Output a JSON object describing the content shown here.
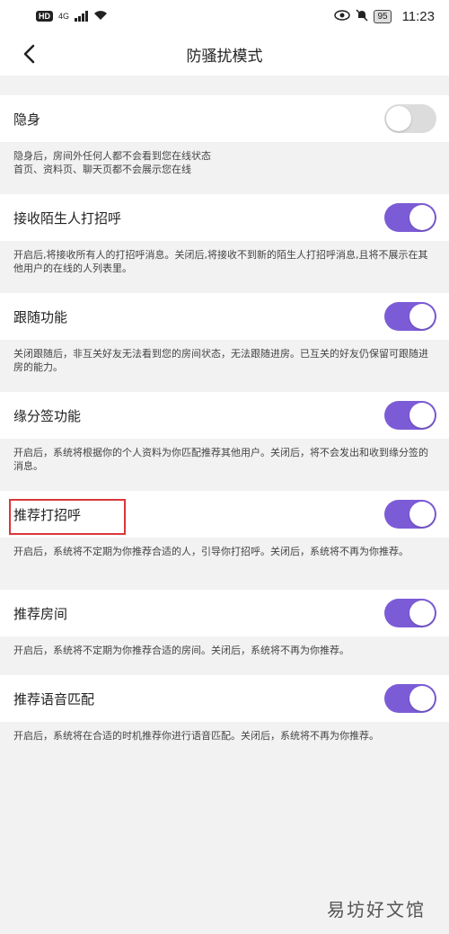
{
  "status_bar": {
    "hd": "HD",
    "network": "4G",
    "battery": "95",
    "time": "11:23"
  },
  "nav": {
    "title": "防骚扰模式"
  },
  "settings": [
    {
      "label": "隐身",
      "on": false,
      "desc": "隐身后，房间外任何人都不会看到您在线状态\n首页、资料页、聊天页都不会展示您在线"
    },
    {
      "label": "接收陌生人打招呼",
      "on": true,
      "desc": "开启后,将接收所有人的打招呼消息。关闭后,将接收不到新的陌生人打招呼消息,且将不展示在其他用户的在线的人列表里。"
    },
    {
      "label": "跟随功能",
      "on": true,
      "desc": "关闭跟随后，非互关好友无法看到您的房间状态，无法跟随进房。已互关的好友仍保留可跟随进房的能力。"
    },
    {
      "label": "缘分签功能",
      "on": true,
      "desc": "开启后，系统将根据你的个人资料为你匹配推荐其他用户。关闭后，将不会发出和收到缘分签的消息。"
    },
    {
      "label": "推荐打招呼",
      "on": true,
      "desc": "开启后，系统将不定期为你推荐合适的人，引导你打招呼。关闭后，系统将不再为你推荐。"
    },
    {
      "label": "推荐房间",
      "on": true,
      "desc": "开启后，系统将不定期为你推荐合适的房间。关闭后，系统将不再为你推荐。"
    },
    {
      "label": "推荐语音匹配",
      "on": true,
      "desc": "开启后，系统将在合适的时机推荐你进行语音匹配。关闭后，系统将不再为你推荐。"
    }
  ],
  "watermark": "易坊好文馆",
  "colors": {
    "toggle_on": "#7c5cd6",
    "toggle_off": "#dcdcdc",
    "highlight": "#d9383a"
  }
}
